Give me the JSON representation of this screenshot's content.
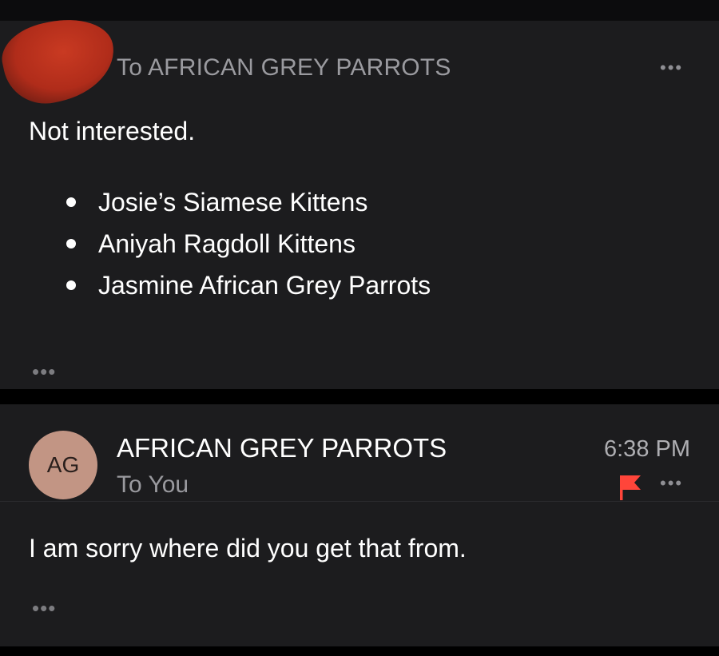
{
  "thread": {
    "previous_message": {
      "recipient_line": "To AFRICAN GREY PARROTS",
      "more_label": "•••",
      "body": "Not interested.",
      "list_items": [
        "Josie’s Siamese Kittens",
        "Aniyah Ragdoll Kittens",
        "Jasmine African Grey Parrots"
      ],
      "expand_label": "•••"
    },
    "latest_message": {
      "avatar_initials": "AG",
      "sender": "AFRICAN GREY PARROTS",
      "recipient_line": "To You",
      "time": "6:38 PM",
      "flag_icon": "flag-icon",
      "more_label": "•••",
      "body": "I am sorry where did you get that from.",
      "expand_label": "•••"
    }
  },
  "colors": {
    "background": "#000000",
    "card": "#1c1c1e",
    "avatar": "#c29584",
    "flag": "#ff453a",
    "secondary_text": "#9a9a9f",
    "redaction": "#c93a22"
  }
}
